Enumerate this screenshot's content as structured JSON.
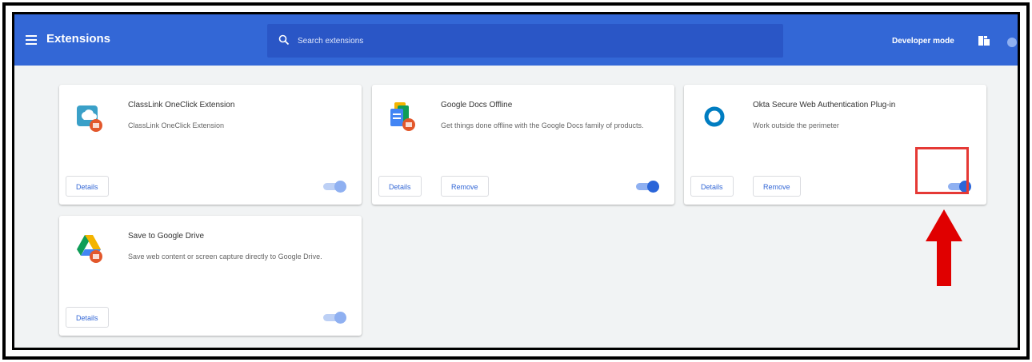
{
  "header": {
    "title": "Extensions",
    "search_placeholder": "Search extensions",
    "developer_mode_label": "Developer mode"
  },
  "extensions": [
    {
      "name": "ClassLink OneClick Extension",
      "description": "ClassLink OneClick Extension",
      "details_label": "Details",
      "remove_label": "",
      "enabled": true
    },
    {
      "name": "Google Docs Offline",
      "description": "Get things done offline with the Google Docs family of products.",
      "details_label": "Details",
      "remove_label": "Remove",
      "enabled": true
    },
    {
      "name": "Okta Secure Web Authentication Plug-in",
      "description": "Work outside the perimeter",
      "details_label": "Details",
      "remove_label": "Remove",
      "enabled": true
    },
    {
      "name": "Save to Google Drive",
      "description": "Save web content or screen capture directly to Google Drive.",
      "details_label": "Details",
      "remove_label": "",
      "enabled": true
    }
  ],
  "icons": [
    "menu-icon",
    "search-icon",
    "developer-mode-icon",
    "classlink-icon",
    "google-docs-icon",
    "okta-icon",
    "google-drive-icon",
    "red-arrow-icon"
  ],
  "colors": {
    "accent": "#3367d6",
    "highlight": "#e53935"
  }
}
